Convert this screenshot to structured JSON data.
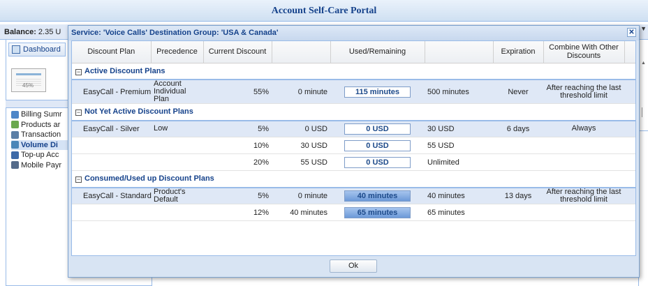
{
  "portal": {
    "title": "Account Self-Care Portal",
    "balance_label": "Balance:",
    "balance_value": "2.35 U",
    "dashboard_tab": "Dashboard",
    "thumb_pct": "45%",
    "nav": [
      {
        "label": "Billing Sumr",
        "icon": "chart-icon",
        "color": "#4d86c8"
      },
      {
        "label": "Products ar",
        "icon": "products-icon",
        "color": "#6aa84f"
      },
      {
        "label": "Transaction",
        "icon": "transactions-icon",
        "color": "#5b7fa6"
      },
      {
        "label": "Volume Di",
        "icon": "volume-icon",
        "color": "#4a86b8"
      },
      {
        "label": "Top-up Acc",
        "icon": "topup-icon",
        "color": "#3d6aa8"
      },
      {
        "label": "Mobile Payr",
        "icon": "mobile-payment-icon",
        "color": "#556b8a"
      }
    ]
  },
  "dialog": {
    "title": "Service: 'Voice Calls' Destination Group: 'USA & Canada'",
    "close_symbol": "✕",
    "ok_label": "Ok",
    "columns": {
      "plan": "Discount Plan",
      "precedence": "Precedence",
      "current": "Current Discount",
      "used": "Used/Remaining",
      "expiration": "Expiration",
      "combine": "Combine With Other Discounts"
    },
    "groups": [
      {
        "title": "Active Discount Plans",
        "rows": [
          {
            "plan": "EasyCall - Premium",
            "precedence": "Account Individual Plan",
            "discount": "55%",
            "used": "0 minute",
            "bar_label": "115 minutes",
            "bar_fill": 0,
            "limit": "500 minutes",
            "expiration": "Never",
            "combine": "After reaching the last threshold limit",
            "style": "sel"
          }
        ]
      },
      {
        "title": "Not Yet Active Discount Plans",
        "rows": [
          {
            "plan": "EasyCall - Silver",
            "precedence": "Low",
            "discount": "5%",
            "used": "0 USD",
            "bar_label": "0 USD",
            "bar_fill": 0,
            "limit": "30 USD",
            "expiration": "6 days",
            "combine": "Always",
            "style": "sel"
          },
          {
            "plan": "",
            "precedence": "",
            "discount": "10%",
            "used": "30 USD",
            "bar_label": "0 USD",
            "bar_fill": 0,
            "limit": "55 USD",
            "expiration": "",
            "combine": "",
            "style": "plain"
          },
          {
            "plan": "",
            "precedence": "",
            "discount": "20%",
            "used": "55 USD",
            "bar_label": "0 USD",
            "bar_fill": 0,
            "limit": "Unlimited",
            "expiration": "",
            "combine": "",
            "style": "plain"
          }
        ]
      },
      {
        "title": "Consumed/Used up Discount Plans",
        "rows": [
          {
            "plan": "EasyCall - Standard",
            "precedence": "Product's Default",
            "discount": "5%",
            "used": "0 minute",
            "bar_label": "40 minutes",
            "bar_fill": 1,
            "limit": "40 minutes",
            "expiration": "13 days",
            "combine": "After reaching the last threshold limit",
            "style": "sel"
          },
          {
            "plan": "",
            "precedence": "",
            "discount": "12%",
            "used": "40 minutes",
            "bar_label": "65 minutes",
            "bar_fill": 1,
            "limit": "65 minutes",
            "expiration": "",
            "combine": "",
            "style": "plain"
          }
        ]
      }
    ]
  }
}
